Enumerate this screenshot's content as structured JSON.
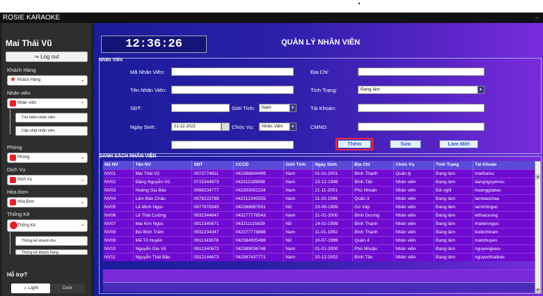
{
  "window": {
    "title": "ROSIE KARAOKE",
    "minimize": "–"
  },
  "sidebar": {
    "username": "Mai Thái Vũ",
    "logout_label": "Log out",
    "sections": [
      {
        "label": "Khách Hàng",
        "dropdown": "Khách Hàng",
        "icon": "star-icon",
        "color": "#e8202a",
        "expanded": false
      },
      {
        "label": "Nhân viên",
        "dropdown": "Nhân viên",
        "icon": "user-icon",
        "color": "#e8202a",
        "expanded": true,
        "items": [
          "Tìm kiếm nhân viên",
          "Cập nhật nhân viên"
        ]
      },
      {
        "label": "Phòng",
        "dropdown": "Phòng",
        "icon": "room-icon",
        "color": "#e8202a",
        "expanded": false
      },
      {
        "label": "Dịch Vụ",
        "dropdown": "Dịch Vụ",
        "icon": "service-icon",
        "color": "#e8202a",
        "expanded": false
      },
      {
        "label": "Hóa Đơn",
        "dropdown": "Hóa Đơn",
        "icon": "invoice-icon",
        "color": "#e8202a",
        "expanded": false
      },
      {
        "label": "Thống Kê",
        "dropdown": "Thống Kê",
        "icon": "pie-chart-icon",
        "color": "#e8202a",
        "expanded": true,
        "items": [
          "Thống kê doanh thu",
          "Thống kê khách hàng"
        ]
      }
    ],
    "help_label": "Hỗ trợ?",
    "light_label": "Light",
    "dark_label": "Dark"
  },
  "header": {
    "clock": "12:36:26",
    "title": "QUẢN LÝ NHÂN VIÊN"
  },
  "form": {
    "legend": "Nhân Viên",
    "ma_nv_label": "Mã Nhân Viên:",
    "ten_nv_label": "Tên Nhân Viên:",
    "sdt_label": "SĐT:",
    "ngay_sinh_label": "Ngày Sinh:",
    "ngay_sinh_value": "01-12-2023",
    "gioi_tinh_label": "Giới Tính:",
    "gioi_tinh_value": "Nam",
    "chuc_vu_label": "Chức Vụ:",
    "chuc_vu_value": "Nhân Viên",
    "dia_chi_label": "Địa Chỉ:",
    "tinh_trang_label": "Tình Trạng:",
    "tinh_trang_value": "Đang làm",
    "tai_khoan_label": "Tài Khoản:",
    "cmnd_label": "CMND:",
    "add_label": "Thêm",
    "edit_label": "Sửa",
    "refresh_label": "Làm Mới"
  },
  "table": {
    "legend": "DANH SÁCH NHÂN VIÊN",
    "columns": [
      "Mã NV",
      "Tên NV",
      "SĐT",
      "CCCD",
      "Giới Tính",
      "Ngày Sinh",
      "Địa Chỉ",
      "Chức Vụ",
      "Tình Trạng",
      "Tài Khoản"
    ],
    "rows": [
      [
        "NV01",
        "Mai Thái Vũ",
        "0973774811",
        "042388844499",
        "Nam",
        "01-01-2001",
        "Bình Thạnh",
        "Quản lý",
        "Đang làm",
        "maithaivu"
      ],
      [
        "NV02",
        "Đặng Nguyễn Vũ",
        "0715344673",
        "042311189898",
        "Nam",
        "23-12-1996",
        "Bình Tân",
        "Nhân viên",
        "Đang làm",
        "dangnguyenvu"
      ],
      [
        "NV03",
        "Hoàng Gia Bảo",
        "0998234777",
        "042303001234",
        "Nam",
        "21-11-2001",
        "Phú Nhuận",
        "Nhân viên",
        "Đã nghỉ",
        "hoanggiabao"
      ],
      [
        "NV04",
        "Lâm Bảo Châu",
        "0978222789",
        "042312345555",
        "Nam",
        "11-10-1996",
        "Quận 3",
        "Nhân viên",
        "Đang làm",
        "lambaochau"
      ],
      [
        "NV05",
        "Lã Minh Ngọc",
        "0977678345",
        "042388887651",
        "Nữ",
        "23-06-1999",
        "Gò Vấp",
        "Nhân viên",
        "Đang làm",
        "laminhngoc"
      ],
      [
        "NV06",
        "Lê Thái Cường",
        "0932344647",
        "043277776543",
        "Nam",
        "21-01-2000",
        "Bình Dương",
        "Nhân viên",
        "Đang làm",
        "lethaicuong"
      ],
      [
        "NV07",
        "Mai Kim Ngọc",
        "0912345671",
        "043211115839",
        "Nữ",
        "14-02-1999",
        "Bình Thạnh",
        "Nhân viên",
        "Đang làm",
        "maikimngoc"
      ],
      [
        "NV08",
        "Bùi Bích Trâm",
        "0932234347",
        "042377778888",
        "Nam",
        "11-01-1992",
        "Bình Thạnh",
        "Nhân viên",
        "Đang làm",
        "buibichtram"
      ],
      [
        "NV09",
        "Mã Tô Huyền",
        "0911343678",
        "042384905488",
        "Nữ",
        "10-07-1999",
        "Quận 4",
        "Nhân viên",
        "Đang làm",
        "matohuyen"
      ],
      [
        "NV10",
        "Nguyễn Gia Vũ",
        "0912340672",
        "042389036748",
        "Nam",
        "01-01-2000",
        "Phú Nhuận",
        "Nhân viên",
        "Đang làm",
        "nguyengiavu"
      ],
      [
        "NV11",
        "Nguyễn Thái Bảo",
        "0312144673",
        "042367437771",
        "Nam",
        "20-12-2002",
        "Bình Tân",
        "Nhân viên",
        "Đang làm",
        "nguyenthaibao"
      ]
    ]
  },
  "colors": {
    "accent": "#6f0ad0",
    "highlight": "#ff2a3a"
  }
}
